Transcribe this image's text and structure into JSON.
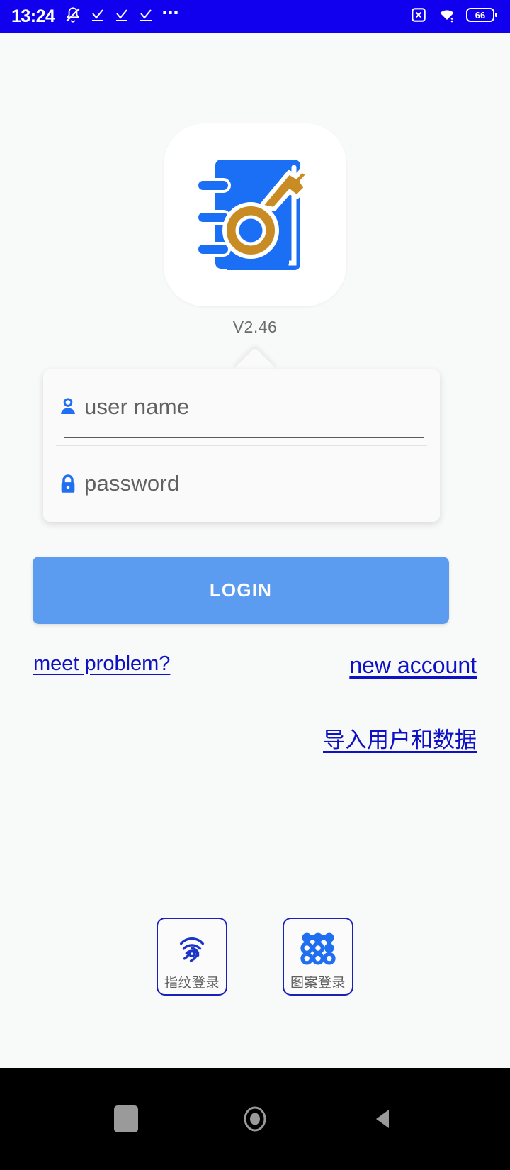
{
  "statusbar": {
    "time": "13:24",
    "ellipsis": "⋯",
    "battery_level": "66",
    "icons": {
      "bell_muted": "bell-muted-icon",
      "check1": "checkmark-underline-icon",
      "check2": "checkmark-underline-icon",
      "check3": "checkmark-underline-icon",
      "more": "more-dots-icon",
      "sim_disabled": "sim-disabled-icon",
      "wifi": "wifi-icon",
      "battery": "battery-icon"
    },
    "background_color": "#1100ee"
  },
  "app": {
    "logo_name": "app-logo-notebook-key",
    "version": "V2.46"
  },
  "form": {
    "username": {
      "value": "",
      "placeholder": "user name",
      "icon": "person-icon"
    },
    "password": {
      "value": "",
      "placeholder": "password",
      "icon": "lock-icon"
    }
  },
  "buttons": {
    "login_label": "LOGIN",
    "login_color": "#5b9bf0"
  },
  "links": {
    "meet_problem": "meet problem?",
    "new_account": "new account",
    "import_data": "导入用户和数据",
    "color": "#0e11c4"
  },
  "alt_login": [
    {
      "label": "指纹登录",
      "icon": "fingerprint-icon",
      "name": "fingerprint-login-button"
    },
    {
      "label": "图案登录",
      "icon": "pattern-lock-icon",
      "name": "pattern-login-button"
    }
  ],
  "navbar": {
    "recents": "recents-square-icon",
    "home": "home-circle-icon",
    "back": "back-triangle-icon"
  }
}
